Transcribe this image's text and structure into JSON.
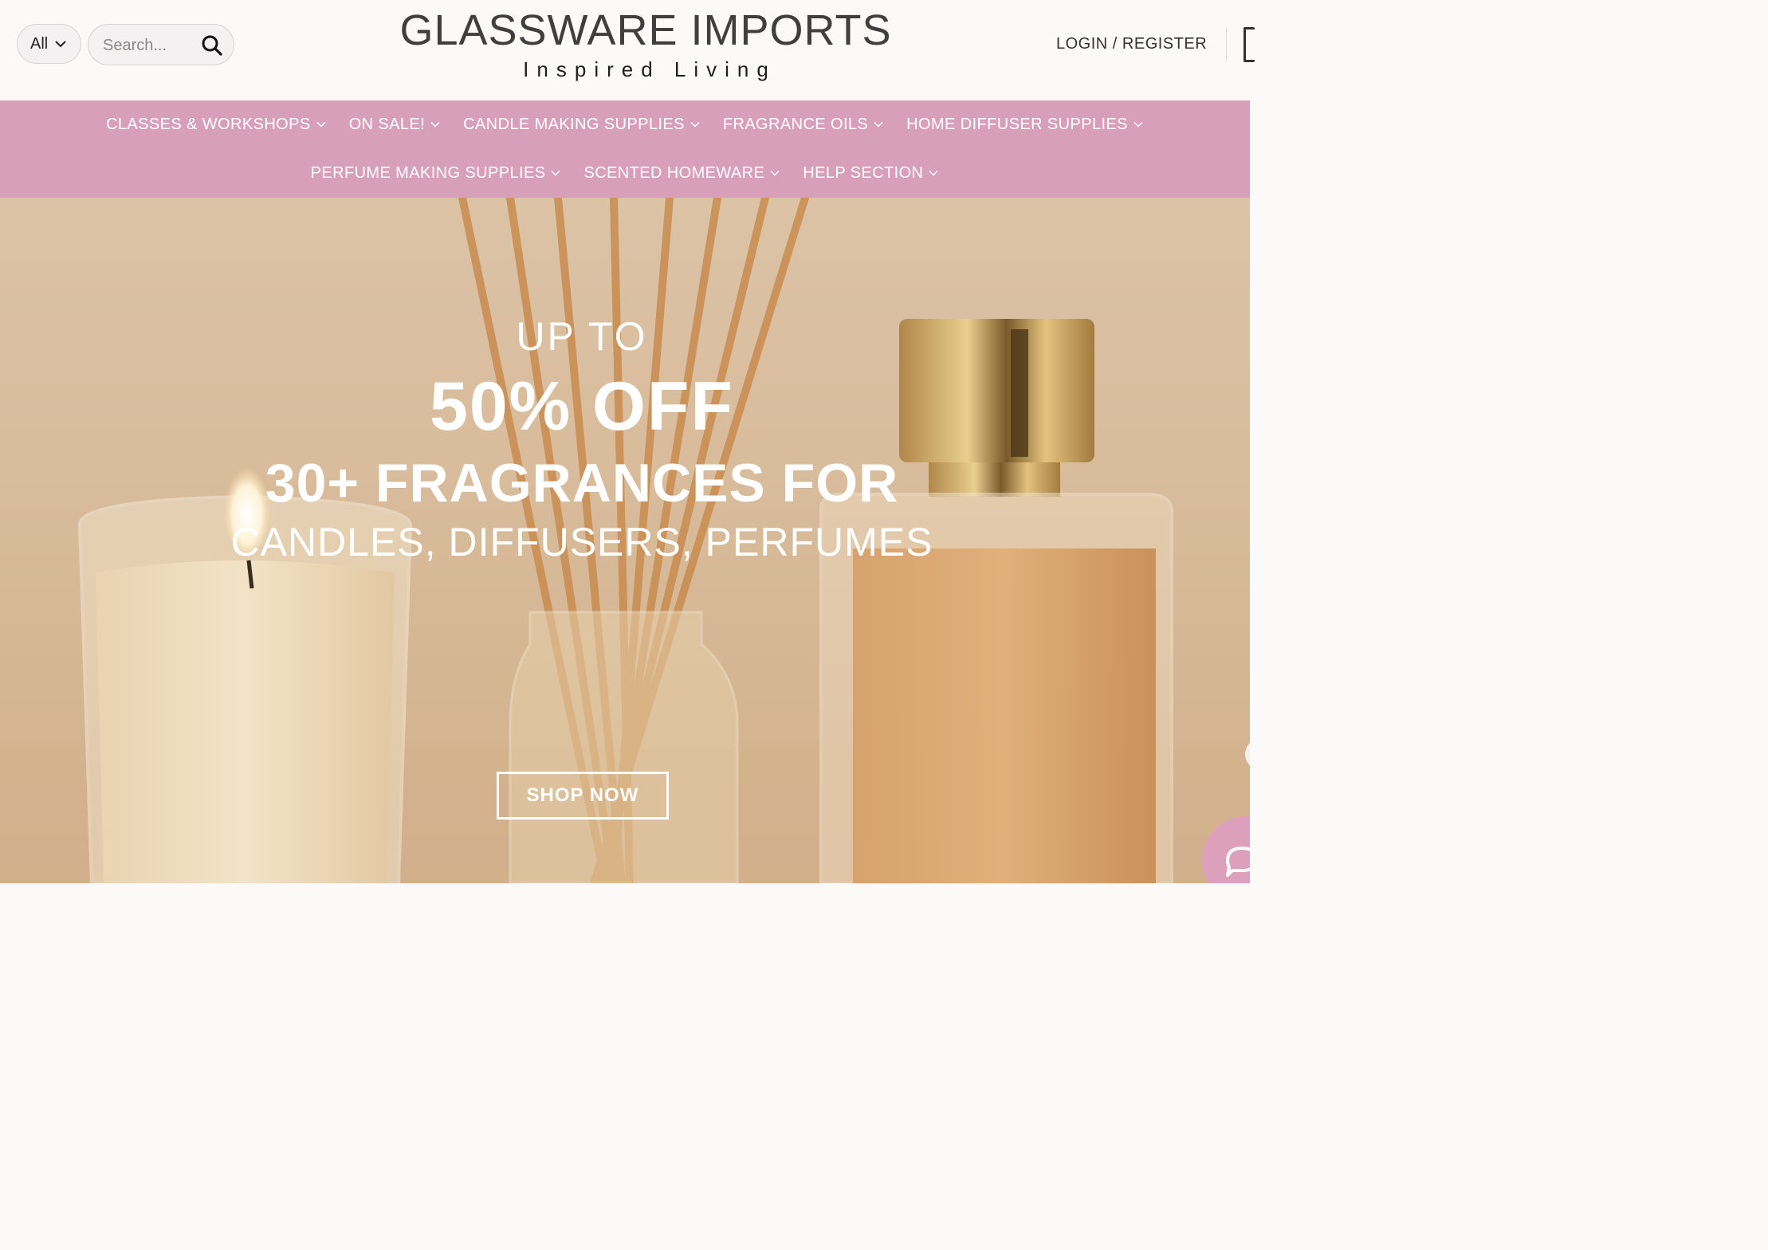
{
  "header": {
    "category_select": {
      "value": "All"
    },
    "search": {
      "placeholder": "Search..."
    },
    "logo": {
      "title": "GLASSWARE IMPORTS",
      "tagline": "Inspired Living"
    },
    "login_label": "LOGIN / REGISTER"
  },
  "nav": {
    "row1": [
      {
        "label": "CLASSES & WORKSHOPS"
      },
      {
        "label": "ON SALE!"
      },
      {
        "label": "CANDLE MAKING SUPPLIES"
      },
      {
        "label": "FRAGRANCE OILS"
      },
      {
        "label": "HOME DIFFUSER SUPPLIES"
      }
    ],
    "row2": [
      {
        "label": "PERFUME MAKING SUPPLIES"
      },
      {
        "label": "SCENTED HOMEWARE"
      },
      {
        "label": "HELP SECTION"
      }
    ]
  },
  "hero": {
    "line1": "UP TO",
    "line2": "50% OFF",
    "line3": "30+ FRAGRANCES FOR",
    "line4": "CANDLES, DIFFUSERS, PERFUMES",
    "cta_label": "SHOP NOW"
  },
  "colors": {
    "nav_bg": "#d89fbb",
    "header_bg": "#fcf9f9",
    "hero_bg": "#d6b795",
    "chat_bg": "#dca0bd"
  },
  "icons": {
    "search": "search-icon",
    "dropdown": "chevron-down-icon",
    "cart": "cart-icon",
    "chat": "chat-icon"
  }
}
